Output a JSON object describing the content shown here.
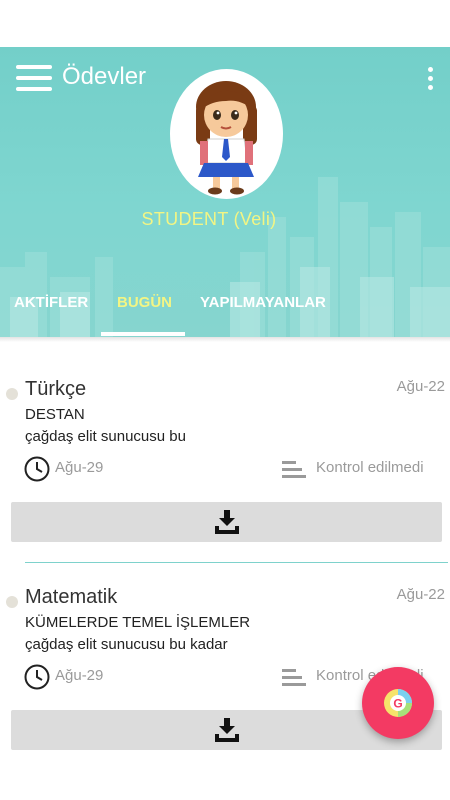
{
  "app": {
    "title": "Ödevler"
  },
  "user": {
    "name": "STUDENT   (Veli)"
  },
  "tabs": [
    {
      "label": "AKTİFLER",
      "active": false
    },
    {
      "label": "BUGÜN",
      "active": true
    },
    {
      "label": "YAPILMAYANLAR",
      "active": false
    }
  ],
  "assignments": [
    {
      "subject": "Türkçe",
      "date": "Ağu-22",
      "topic": "DESTAN",
      "description": "çağdaş elit sunucusu bu",
      "due": "Ağu-29",
      "status": "Kontrol edilmedi"
    },
    {
      "subject": "Matematik",
      "date": "Ağu-22",
      "topic": "KÜMELERDE TEMEL İŞLEMLER",
      "description": "çağdaş elit sunucusu bu kadar",
      "due": "Ağu-29",
      "status": "Kontrol edilmedi"
    }
  ],
  "colors": {
    "header": "#7fd6d0",
    "accent_text": "#f2f584",
    "fab": "#f33a63",
    "divider": "#7ed2cc"
  },
  "icons": [
    "menu-icon",
    "more-vert-icon",
    "clock-icon",
    "lines-icon",
    "download-icon",
    "g-logo-icon"
  ]
}
